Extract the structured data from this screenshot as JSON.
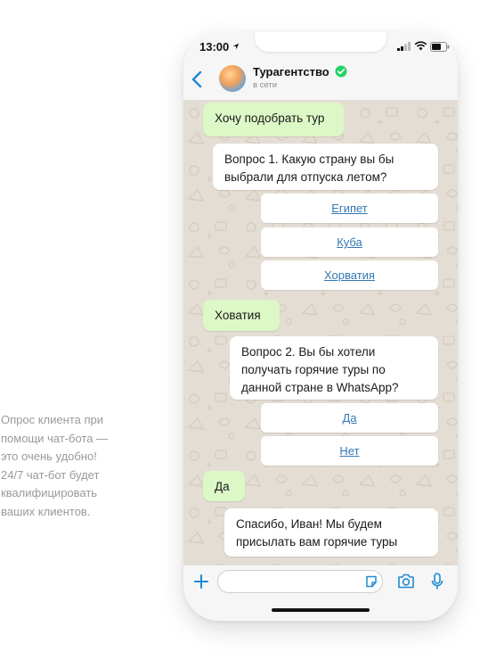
{
  "caption": {
    "lines": [
      "Опрос клиента при",
      "помощи чат-бота —",
      "это очень удобно!",
      "24/7 чат-бот будет",
      "квалифицировать",
      "ваших клиентов."
    ]
  },
  "status_bar": {
    "time": "13:00"
  },
  "header": {
    "name": "Турагентство",
    "status": "в сети"
  },
  "messages": {
    "m1": "Хочу подобрать тур",
    "m2": "Вопрос 1. Какую страну вы бы выбрали для отпуска летом?",
    "q1_options": [
      "Египет",
      "Куба",
      "Хорватия"
    ],
    "m3": "Ховатия",
    "m4": "Вопрос 2. Вы бы хотели получать горячие туры по данной стране в WhatsApp?",
    "q2_options": [
      "Да",
      "Нет"
    ],
    "m5": "Да",
    "m6": "Спасибо, Иван! Мы будем присылать вам горячие туры"
  },
  "colors": {
    "outgoing_bubble": "#dcf8c6",
    "incoming_bubble": "#ffffff",
    "link": "#3478b3",
    "accent": "#1e8ad6",
    "verified": "#25d366",
    "wallpaper": "#e4ddd3"
  }
}
